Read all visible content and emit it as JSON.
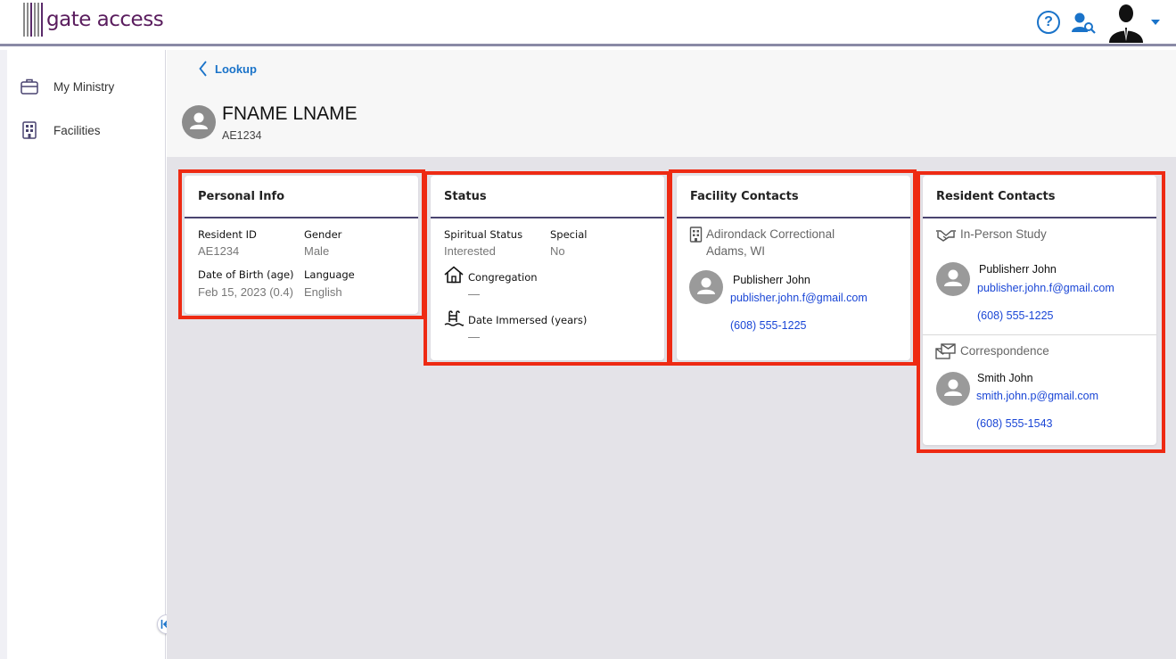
{
  "app": {
    "logo_text": "gate access"
  },
  "topbar": {
    "help_icon": "help-circle-icon",
    "user_search_icon": "user-search-icon",
    "avatar_icon": "user-avatar-icon"
  },
  "sidebar": {
    "items": [
      {
        "label": "My Ministry",
        "icon": "briefcase-icon"
      },
      {
        "label": "Facilities",
        "icon": "building-icon"
      }
    ]
  },
  "header": {
    "back_label": "Lookup",
    "resident_name": "FNAME LNAME",
    "resident_id": "AE1234"
  },
  "personal_info": {
    "title": "Personal Info",
    "resident_id_label": "Resident ID",
    "resident_id_value": "AE1234",
    "gender_label": "Gender",
    "gender_value": "Male",
    "dob_label": "Date of Birth (age)",
    "dob_value": "Feb 15, 2023 (0.4)",
    "language_label": "Language",
    "language_value": "English"
  },
  "status": {
    "title": "Status",
    "spiritual_label": "Spiritual Status",
    "spiritual_value": "Interested",
    "special_label": "Special",
    "special_value": "No",
    "congregation_label": "Congregation",
    "congregation_value": "—",
    "immersed_label": "Date Immersed (years)",
    "immersed_value": "—"
  },
  "facility_contacts": {
    "title": "Facility Contacts",
    "facility_name": "Adirondack Correctional",
    "facility_location": "Adams, WI",
    "contact_name": "Publisherr John",
    "contact_email": "publisher.john.f@gmail.com",
    "contact_phone": "(608) 555-1225"
  },
  "resident_contacts": {
    "title": "Resident Contacts",
    "groups": [
      {
        "label": "In-Person Study",
        "name": "Publisherr John",
        "email": "publisher.john.f@gmail.com",
        "phone": "(608) 555-1225"
      },
      {
        "label": "Correspondence",
        "name": "Smith John",
        "email": "smith.john.p@gmail.com",
        "phone": "(608) 555-1543"
      }
    ]
  },
  "colors": {
    "accent": "#1a73c9",
    "highlight": "#ee2a13",
    "rule": "#4a4470",
    "brand": "#5a1d5e"
  }
}
